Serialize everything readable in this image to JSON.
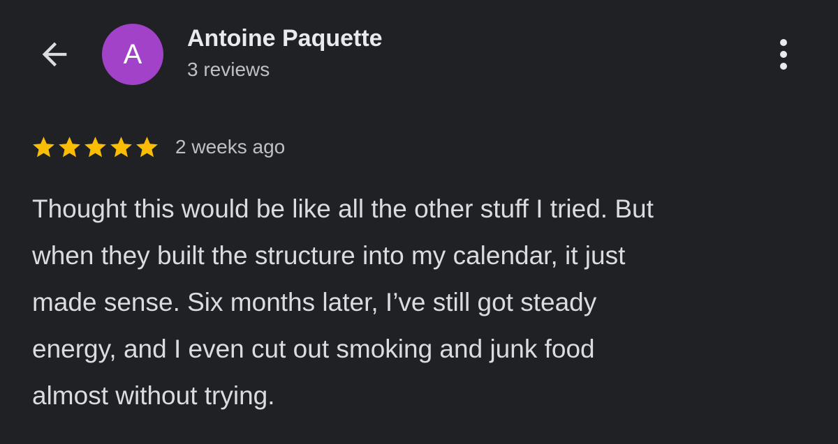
{
  "header": {
    "back_icon": "arrow-back-icon",
    "avatar_letter": "A",
    "avatar_color": "#a142c9",
    "author_name": "Antoine Paquette",
    "review_count": "3 reviews",
    "more_icon": "more-vert-icon"
  },
  "review": {
    "rating": 5,
    "rating_max": 5,
    "star_color": "#fbbc04",
    "date": "2 weeks ago",
    "lines": [
      "Thought this would be like all the other stuff I tried. But",
      "when they built the structure into my calendar, it just",
      "made sense. Six months later, I’ve still got steady",
      "energy, and I even cut out smoking and junk food",
      "almost without trying."
    ]
  },
  "theme": {
    "background": "#202124",
    "text_primary": "#e8eaed",
    "text_secondary": "#bdc1c6"
  }
}
